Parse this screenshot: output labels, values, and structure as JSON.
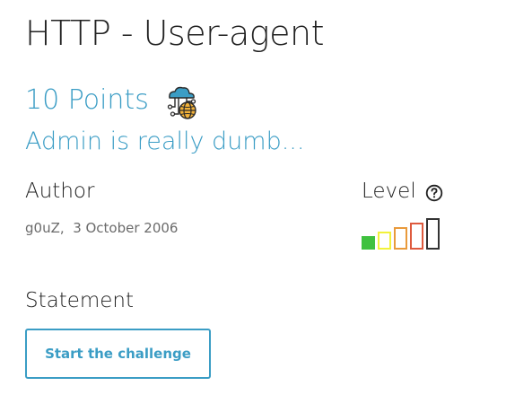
{
  "challenge": {
    "title": "HTTP - User-agent",
    "points": "10 Points",
    "category_icon": "cloud-network-globe-icon",
    "subtitle": "Admin is really dumb..."
  },
  "author": {
    "heading": "Author",
    "name": "g0uZ",
    "separator": ",",
    "date": "3 October 2006"
  },
  "level": {
    "heading": "Level",
    "help_icon": "question-circle-icon",
    "value": 1,
    "max": 5,
    "bar_colors": [
      "#3fc13f",
      "#f2f23a",
      "#e99a3b",
      "#de5a3e",
      "#333333"
    ]
  },
  "statement": {
    "heading": "Statement",
    "start_button_label": "Start the challenge"
  },
  "colors": {
    "accent": "#3b9dc5",
    "text": "#212121",
    "muted": "#6b6b6b"
  }
}
